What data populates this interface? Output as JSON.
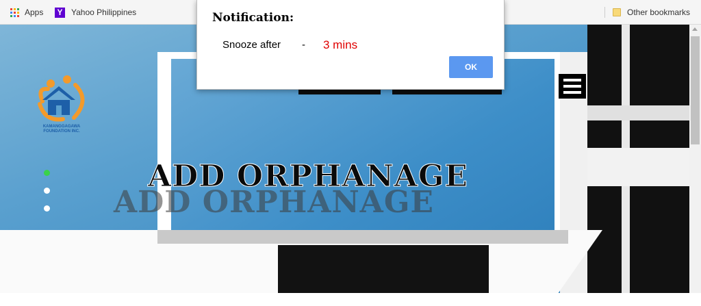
{
  "bookmarks": {
    "apps_label": "Apps",
    "yahoo_label": "Yahoo Philippines",
    "other_label": "Other bookmarks",
    "apps_colors": [
      "#ea4335",
      "#fbbc05",
      "#34a853",
      "#4285f4",
      "#ea4335",
      "#fbbc05",
      "#34a853",
      "#4285f4",
      "#ea4335"
    ]
  },
  "hero": {
    "logo_text": "KAMANGGAGAWA FOUNDATION INC.",
    "title": "ADD ORPHANAGE",
    "title_reflection": "ADD ORPHANAGE",
    "slides": [
      {
        "active": true
      },
      {
        "active": false
      },
      {
        "active": false
      }
    ]
  },
  "dialog": {
    "title": "Notification:",
    "label": "Snooze after",
    "separator": "-",
    "value": "3 mins",
    "ok_label": "OK",
    "value_color": "#e00000",
    "button_color": "#5b98f0"
  },
  "colors": {
    "active_dot": "#3ad24a",
    "logo_blue": "#1d5fa8",
    "logo_orange": "#f39a2b"
  }
}
